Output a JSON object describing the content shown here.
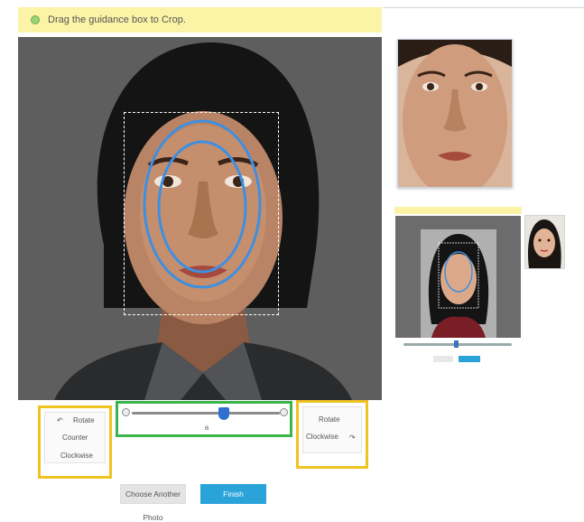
{
  "banner": {
    "icon": "info-dot-icon",
    "text": "Drag the guidance box to Crop."
  },
  "rotate_left": {
    "line1": "Rotate",
    "line2": "Counter",
    "line3": "Clockwise",
    "icon": "rotate-counterclockwise-icon"
  },
  "rotate_right": {
    "line1": "Rotate",
    "line2": "Clockwise",
    "icon": "rotate-clockwise-icon"
  },
  "zoom": {
    "value": 0.62,
    "label": "a"
  },
  "buttons": {
    "choose_line1": "Choose Another",
    "choose_line2": "Photo",
    "finish": "Finish"
  },
  "colors": {
    "banner_bg": "#fbf3a6",
    "highlight_yellow": "#f0c322",
    "highlight_green": "#39b54a",
    "accent_blue": "#2aa3d8",
    "guide_blue": "#3f8fe0"
  }
}
